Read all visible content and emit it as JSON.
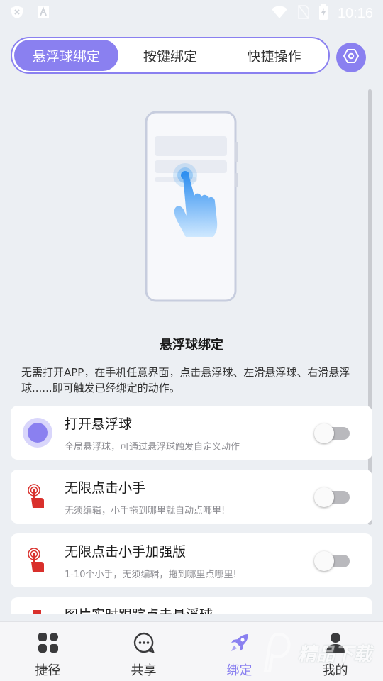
{
  "status_bar": {
    "time": "10:16"
  },
  "tabs": [
    {
      "label": "悬浮球绑定",
      "active": true
    },
    {
      "label": "按键绑定",
      "active": false
    },
    {
      "label": "快捷操作",
      "active": false
    }
  ],
  "section": {
    "title": "悬浮球绑定",
    "description": "无需打开APP，在手机任意界面，点击悬浮球、左滑悬浮球、右滑悬浮球......即可触发已经绑定的动作。"
  },
  "cards": [
    {
      "title": "打开悬浮球",
      "subtitle": "全局悬浮球，可通过悬浮球触发自定义动作",
      "enabled": false,
      "icon": "floating-ball-icon"
    },
    {
      "title": "无限点击小手",
      "subtitle": "无须编辑，小手拖到哪里就自动点哪里!",
      "enabled": false,
      "icon": "tap-hand-icon"
    },
    {
      "title": "无限点击小手加强版",
      "subtitle": "1-10个小手，无须编辑，拖到哪里点哪里!",
      "enabled": false,
      "icon": "tap-hand-icon"
    },
    {
      "title": "图片实时跟踪点击悬浮球",
      "subtitle": "",
      "enabled": false,
      "icon": "tap-hand-icon"
    }
  ],
  "bottom_nav": [
    {
      "label": "捷径",
      "icon": "grid-icon",
      "active": false
    },
    {
      "label": "共享",
      "icon": "chat-icon",
      "active": false
    },
    {
      "label": "绑定",
      "icon": "rocket-icon",
      "active": true
    },
    {
      "label": "我的",
      "icon": "person-icon",
      "active": false
    }
  ],
  "colors": {
    "accent": "#8a80f0",
    "hand_blue": "#3a9cf0",
    "tap_red": "#d9302c"
  },
  "watermark": {
    "text": "精品下载"
  }
}
